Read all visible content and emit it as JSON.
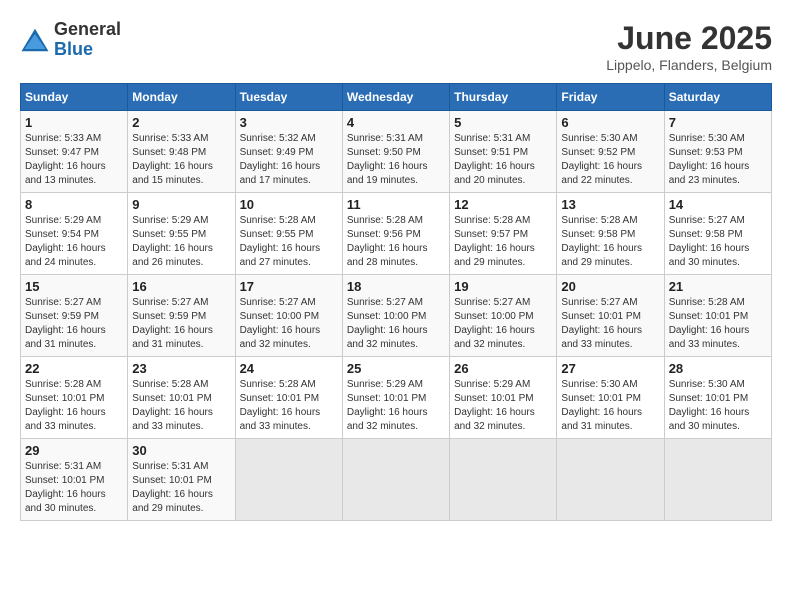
{
  "logo": {
    "general": "General",
    "blue": "Blue"
  },
  "title": "June 2025",
  "location": "Lippelo, Flanders, Belgium",
  "days_of_week": [
    "Sunday",
    "Monday",
    "Tuesday",
    "Wednesday",
    "Thursday",
    "Friday",
    "Saturday"
  ],
  "weeks": [
    [
      {
        "day": "1",
        "sunrise": "5:33 AM",
        "sunset": "9:47 PM",
        "daylight": "16 hours and 13 minutes."
      },
      {
        "day": "2",
        "sunrise": "5:33 AM",
        "sunset": "9:48 PM",
        "daylight": "16 hours and 15 minutes."
      },
      {
        "day": "3",
        "sunrise": "5:32 AM",
        "sunset": "9:49 PM",
        "daylight": "16 hours and 17 minutes."
      },
      {
        "day": "4",
        "sunrise": "5:31 AM",
        "sunset": "9:50 PM",
        "daylight": "16 hours and 19 minutes."
      },
      {
        "day": "5",
        "sunrise": "5:31 AM",
        "sunset": "9:51 PM",
        "daylight": "16 hours and 20 minutes."
      },
      {
        "day": "6",
        "sunrise": "5:30 AM",
        "sunset": "9:52 PM",
        "daylight": "16 hours and 22 minutes."
      },
      {
        "day": "7",
        "sunrise": "5:30 AM",
        "sunset": "9:53 PM",
        "daylight": "16 hours and 23 minutes."
      }
    ],
    [
      {
        "day": "8",
        "sunrise": "5:29 AM",
        "sunset": "9:54 PM",
        "daylight": "16 hours and 24 minutes."
      },
      {
        "day": "9",
        "sunrise": "5:29 AM",
        "sunset": "9:55 PM",
        "daylight": "16 hours and 26 minutes."
      },
      {
        "day": "10",
        "sunrise": "5:28 AM",
        "sunset": "9:55 PM",
        "daylight": "16 hours and 27 minutes."
      },
      {
        "day": "11",
        "sunrise": "5:28 AM",
        "sunset": "9:56 PM",
        "daylight": "16 hours and 28 minutes."
      },
      {
        "day": "12",
        "sunrise": "5:28 AM",
        "sunset": "9:57 PM",
        "daylight": "16 hours and 29 minutes."
      },
      {
        "day": "13",
        "sunrise": "5:28 AM",
        "sunset": "9:58 PM",
        "daylight": "16 hours and 29 minutes."
      },
      {
        "day": "14",
        "sunrise": "5:27 AM",
        "sunset": "9:58 PM",
        "daylight": "16 hours and 30 minutes."
      }
    ],
    [
      {
        "day": "15",
        "sunrise": "5:27 AM",
        "sunset": "9:59 PM",
        "daylight": "16 hours and 31 minutes."
      },
      {
        "day": "16",
        "sunrise": "5:27 AM",
        "sunset": "9:59 PM",
        "daylight": "16 hours and 31 minutes."
      },
      {
        "day": "17",
        "sunrise": "5:27 AM",
        "sunset": "10:00 PM",
        "daylight": "16 hours and 32 minutes."
      },
      {
        "day": "18",
        "sunrise": "5:27 AM",
        "sunset": "10:00 PM",
        "daylight": "16 hours and 32 minutes."
      },
      {
        "day": "19",
        "sunrise": "5:27 AM",
        "sunset": "10:00 PM",
        "daylight": "16 hours and 32 minutes."
      },
      {
        "day": "20",
        "sunrise": "5:27 AM",
        "sunset": "10:01 PM",
        "daylight": "16 hours and 33 minutes."
      },
      {
        "day": "21",
        "sunrise": "5:28 AM",
        "sunset": "10:01 PM",
        "daylight": "16 hours and 33 minutes."
      }
    ],
    [
      {
        "day": "22",
        "sunrise": "5:28 AM",
        "sunset": "10:01 PM",
        "daylight": "16 hours and 33 minutes."
      },
      {
        "day": "23",
        "sunrise": "5:28 AM",
        "sunset": "10:01 PM",
        "daylight": "16 hours and 33 minutes."
      },
      {
        "day": "24",
        "sunrise": "5:28 AM",
        "sunset": "10:01 PM",
        "daylight": "16 hours and 33 minutes."
      },
      {
        "day": "25",
        "sunrise": "5:29 AM",
        "sunset": "10:01 PM",
        "daylight": "16 hours and 32 minutes."
      },
      {
        "day": "26",
        "sunrise": "5:29 AM",
        "sunset": "10:01 PM",
        "daylight": "16 hours and 32 minutes."
      },
      {
        "day": "27",
        "sunrise": "5:30 AM",
        "sunset": "10:01 PM",
        "daylight": "16 hours and 31 minutes."
      },
      {
        "day": "28",
        "sunrise": "5:30 AM",
        "sunset": "10:01 PM",
        "daylight": "16 hours and 30 minutes."
      }
    ],
    [
      {
        "day": "29",
        "sunrise": "5:31 AM",
        "sunset": "10:01 PM",
        "daylight": "16 hours and 30 minutes."
      },
      {
        "day": "30",
        "sunrise": "5:31 AM",
        "sunset": "10:01 PM",
        "daylight": "16 hours and 29 minutes."
      },
      {
        "day": "",
        "sunrise": "",
        "sunset": "",
        "daylight": ""
      },
      {
        "day": "",
        "sunrise": "",
        "sunset": "",
        "daylight": ""
      },
      {
        "day": "",
        "sunrise": "",
        "sunset": "",
        "daylight": ""
      },
      {
        "day": "",
        "sunrise": "",
        "sunset": "",
        "daylight": ""
      },
      {
        "day": "",
        "sunrise": "",
        "sunset": "",
        "daylight": ""
      }
    ]
  ]
}
